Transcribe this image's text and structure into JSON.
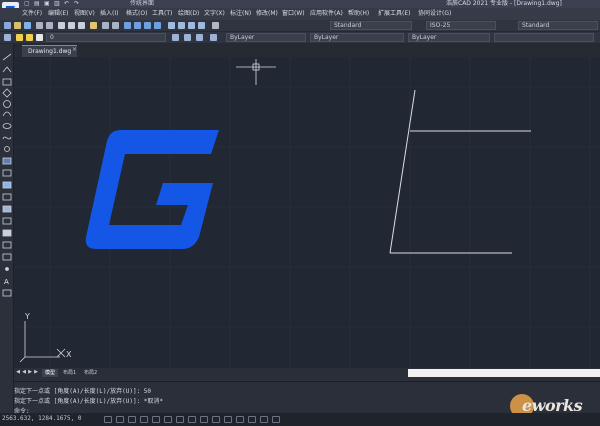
{
  "app": {
    "window_title": "浩辰CAD 2021 专业版 - [Drawing1.dwg]",
    "quick_access_label": "传统界面"
  },
  "menubar": {
    "items": [
      "文件(F)",
      "编辑(E)",
      "视图(V)",
      "插入(I)",
      "格式(O)",
      "工具(T)",
      "绘图(D)",
      "文字(X)",
      "标注(N)",
      "修改(M)",
      "窗口(W)",
      "应用软件(A)",
      "帮助(H)",
      "扩展工具(E)",
      "协同设计(G)"
    ]
  },
  "toolbar": {
    "text_style": "Standard",
    "dim_style": "ISO-25",
    "table_style": "Standard",
    "layer": "0",
    "color": "ByLayer",
    "linetype": "ByLayer",
    "lineweight": "ByLayer"
  },
  "tabs": {
    "document": "Drawing1.dwg",
    "close_symbol": "×"
  },
  "layout_tabs": [
    "模型",
    "布局1",
    "布局2"
  ],
  "ucs": {
    "x_label": "X",
    "y_label": "Y"
  },
  "command": {
    "lines": [
      "指定下一点或 [角度(A)/长度(L)/放弃(U)]: 50",
      "指定下一点或 [角度(A)/长度(L)/放弃(U)]: *取消*"
    ],
    "prompt": "命令:"
  },
  "status": {
    "coordinates": "2563.632, 1284.1675, 0"
  },
  "watermark": {
    "text": "eworks"
  },
  "colors": {
    "logo_blue": "#1456e6",
    "canvas_bg": "#212733",
    "line_color": "#d9dde4"
  }
}
